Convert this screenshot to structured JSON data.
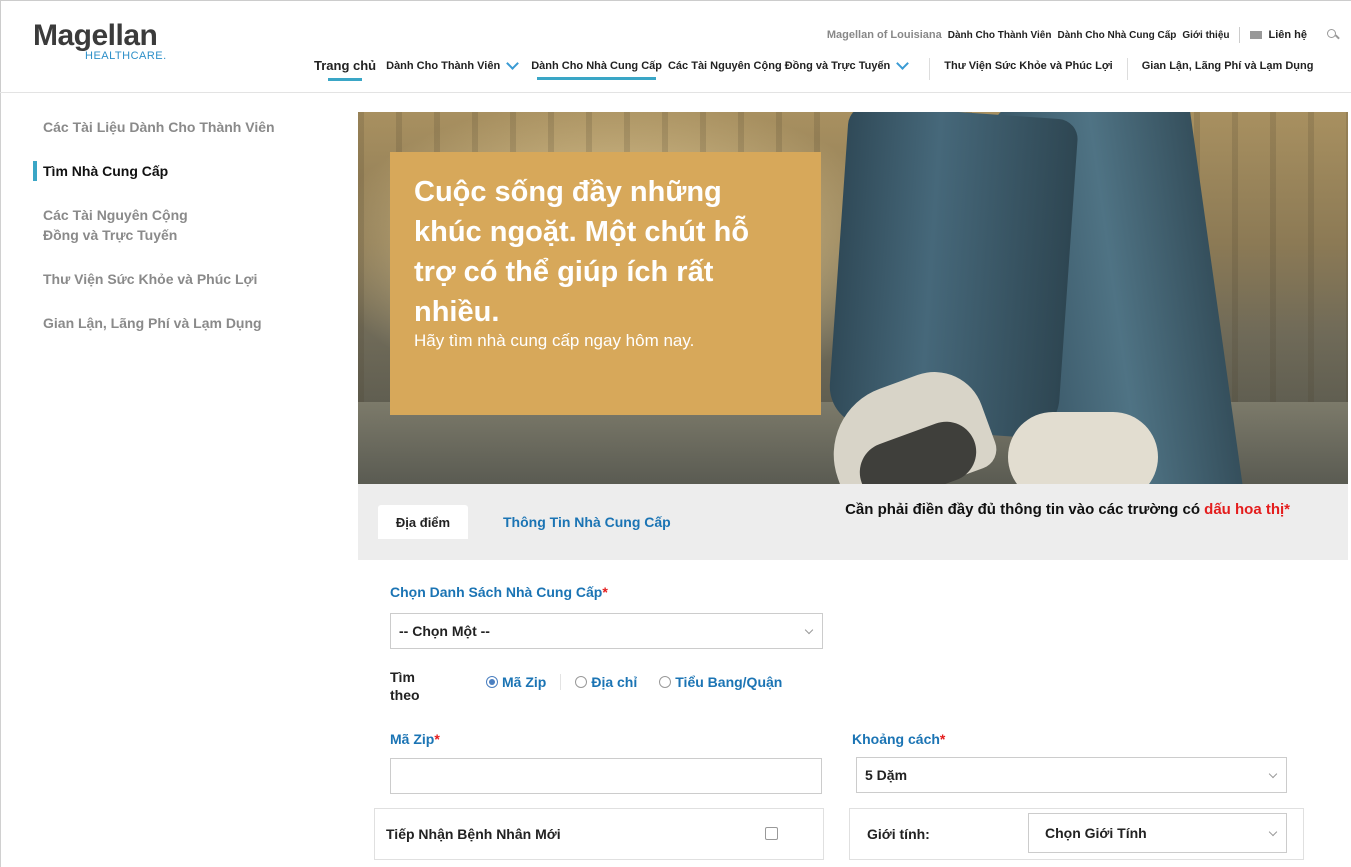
{
  "header": {
    "logo_main": "Magellan",
    "logo_sub": "HEALTHCARE.",
    "brand_name": "Magellan of Louisiana",
    "util_links": [
      "Dành Cho Thành Viên",
      "Dành Cho Nhà Cung Cấp",
      "Giới thiệu"
    ],
    "contact_label": "Liên hệ",
    "nav": {
      "home": "Trang chủ",
      "members": "Dành Cho Thành Viên",
      "providers": "Dành Cho Nhà Cung Cấp",
      "resources": "Các Tài Nguyên Cộng Đồng và Trực Tuyến",
      "library": "Thư Viện Sức Khỏe và Phúc Lợi",
      "fraud": "Gian Lận, Lãng Phí và Lạm Dụng"
    }
  },
  "sidebar": {
    "items": [
      {
        "label": "Các Tài Liệu Dành Cho Thành Viên"
      },
      {
        "label": "Tìm Nhà Cung Cấp"
      },
      {
        "label": "Các Tài Nguyên Cộng Đồng và Trực Tuyến"
      },
      {
        "label": "Thư Viện Sức Khỏe và Phúc Lợi"
      },
      {
        "label": "Gian Lận, Lãng Phí và Lạm Dụng"
      }
    ]
  },
  "hero": {
    "title": "Cuộc sống đầy những khúc ngoặt. Một chút hỗ trợ có thể giúp ích rất nhiều.",
    "subtitle": "Hãy tìm nhà cung cấp ngay hôm nay."
  },
  "tabs": {
    "location": "Địa điểm",
    "provider_info": "Thông Tin Nhà Cung Cấp"
  },
  "required_note": {
    "text": "Cần phải điền đầy đủ thông tin vào các trường có ",
    "highlight": "dấu hoa thị*"
  },
  "form": {
    "provider_list_label": "Chọn Danh Sách Nhà Cung Cấp",
    "asterisk": "*",
    "provider_list_value": "-- Chọn Một --",
    "find_by_label": "Tìm theo",
    "radios": [
      {
        "label": "Mã Zip",
        "checked": true
      },
      {
        "label": "Địa chỉ",
        "checked": false
      },
      {
        "label": "Tiểu Bang/Quận",
        "checked": false
      }
    ],
    "zip_label": "Mã Zip",
    "zip_value": "",
    "distance_label": "Khoảng cách",
    "distance_value": "5 Dặm",
    "new_patients_label": "Tiếp Nhận Bệnh Nhân Mới",
    "gender_label": "Giới tính:",
    "gender_value": "Chọn Giới Tính"
  },
  "colors": {
    "accent": "#3aa6c6",
    "link": "#1b74b4",
    "promo_bg": "#d7a85a",
    "required": "#e41d1d"
  }
}
